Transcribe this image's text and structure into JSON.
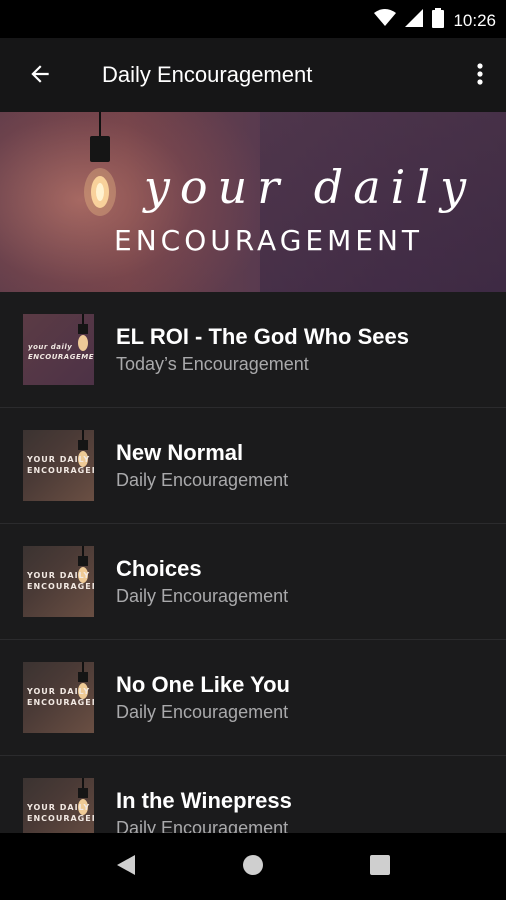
{
  "status_bar": {
    "time": "10:26"
  },
  "app_bar": {
    "title": "Daily Encouragement"
  },
  "hero": {
    "line1": "your daily",
    "line2": "ENCOURAGEMENT"
  },
  "items": [
    {
      "title": "EL ROI - The God Who Sees",
      "subtitle": "Today’s Encouragement",
      "thumb_text": "your daily ENCOURAGEMENT"
    },
    {
      "title": "New Normal",
      "subtitle": "Daily Encouragement",
      "thumb_text": "YOUR DAILY ENCOURAGEMENT"
    },
    {
      "title": "Choices",
      "subtitle": "Daily Encouragement",
      "thumb_text": "YOUR DAILY ENCOURAGEMENT"
    },
    {
      "title": "No One Like You",
      "subtitle": "Daily Encouragement",
      "thumb_text": "YOUR DAILY ENCOURAGEMENT"
    },
    {
      "title": "In the Winepress",
      "subtitle": "Daily Encouragement",
      "thumb_text": "YOUR DAILY ENCOURAGEMENT"
    }
  ],
  "icons": {
    "wifi": "wifi-icon",
    "signal": "signal-icon",
    "battery": "battery-icon",
    "back": "arrow-back-icon",
    "menu": "more-vert-icon",
    "nav_back": "triangle-back-icon",
    "nav_home": "circle-home-icon",
    "nav_recents": "square-recents-icon"
  },
  "colors": {
    "background": "#1b1b1c",
    "app_bar": "#161617",
    "subtitle": "#a9a9ab"
  }
}
